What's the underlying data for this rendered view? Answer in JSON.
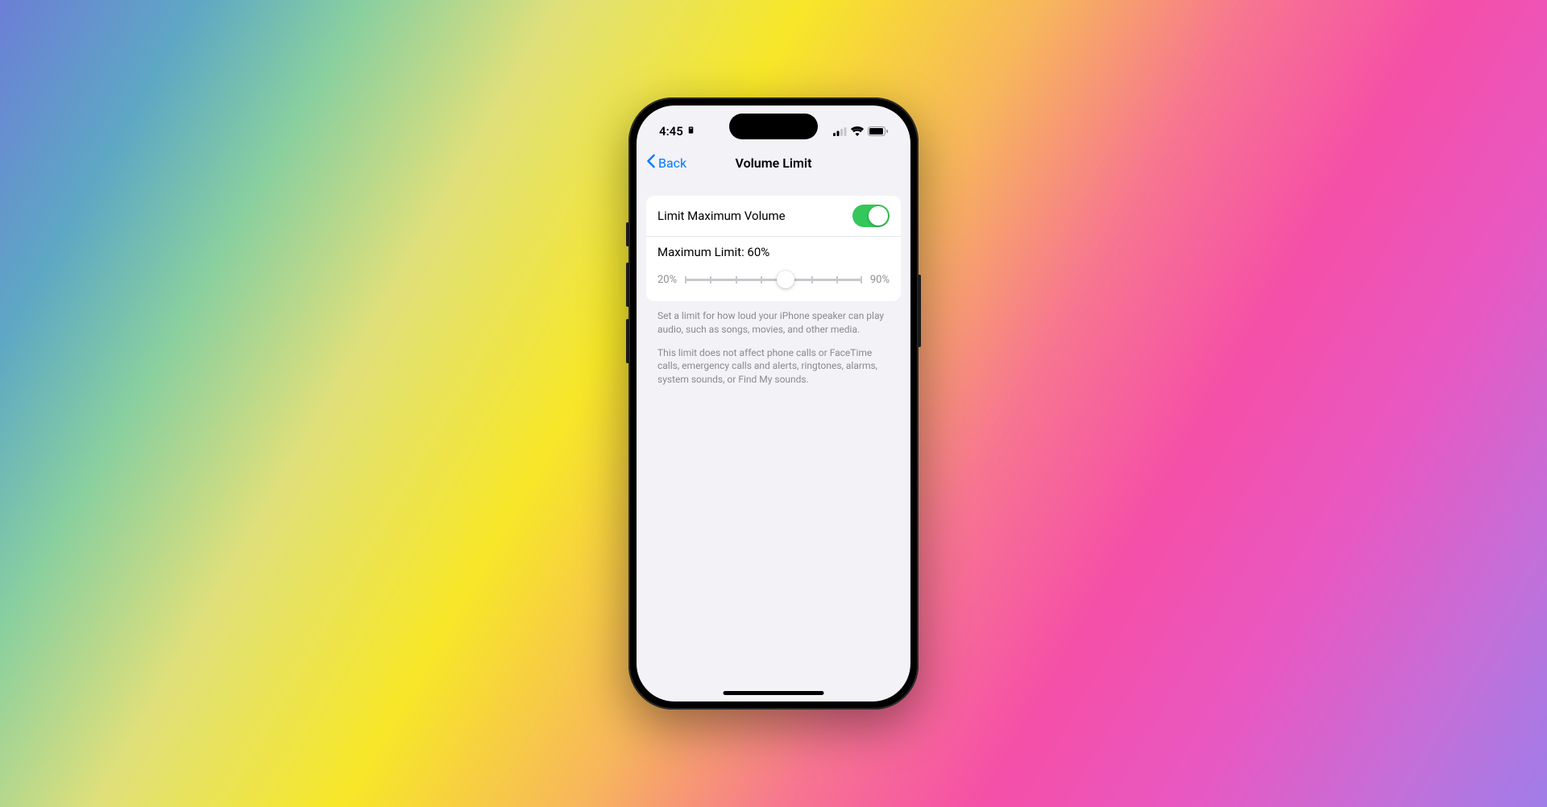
{
  "statusBar": {
    "time": "4:45"
  },
  "nav": {
    "back": "Back",
    "title": "Volume Limit"
  },
  "settings": {
    "limitToggleLabel": "Limit Maximum Volume",
    "toggleOn": true,
    "maxLimitLabel": "Maximum Limit: 60%",
    "sliderMinLabel": "20%",
    "sliderMaxLabel": "90%",
    "sliderMin": 20,
    "sliderMax": 90,
    "sliderValue": 60,
    "sliderPercent": 57
  },
  "footer": {
    "p1": "Set a limit for how loud your iPhone speaker can play audio, such as songs, movies, and other media.",
    "p2": "This limit does not affect phone calls or FaceTime calls, emergency calls and alerts, ringtones, alarms, system sounds, or Find My sounds."
  }
}
